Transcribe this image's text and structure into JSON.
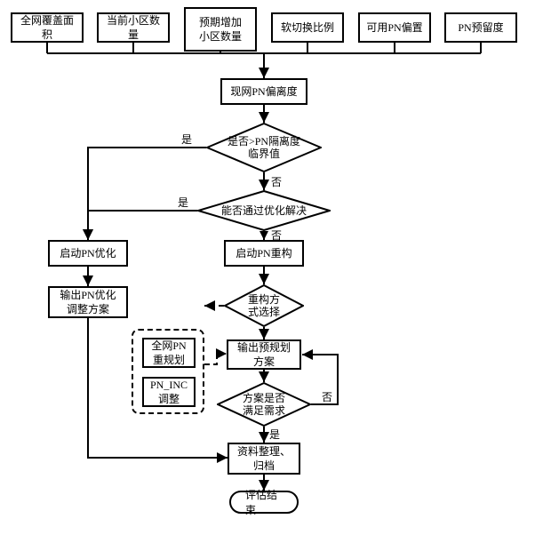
{
  "inputs": {
    "i0": "全网覆盖面积",
    "i1": "当前小区数量",
    "i2": "预期增加\n小区数量",
    "i3": "软切换比例",
    "i4": "可用PN偏置",
    "i5": "PN预留度"
  },
  "nodes": {
    "current_offset": "现网PN偏离度",
    "d_threshold": "是否>PN隔离度\n临界值",
    "d_optimize": "能否通过优化解决",
    "start_opt": "启动PN优化",
    "start_rebuild": "启动PN重构",
    "output_opt": "输出PN优化\n调整方案",
    "d_select": "重构方\n式选择",
    "group_replan": "全网PN\n重规划",
    "group_inc": "PN_INC\n调整",
    "output_pre": "输出预规划\n方案",
    "d_meet": "方案是否\n满足需求",
    "archive": "资料整理、\n归档",
    "result": "评估结束"
  },
  "labels": {
    "yes": "是",
    "no": "否"
  }
}
